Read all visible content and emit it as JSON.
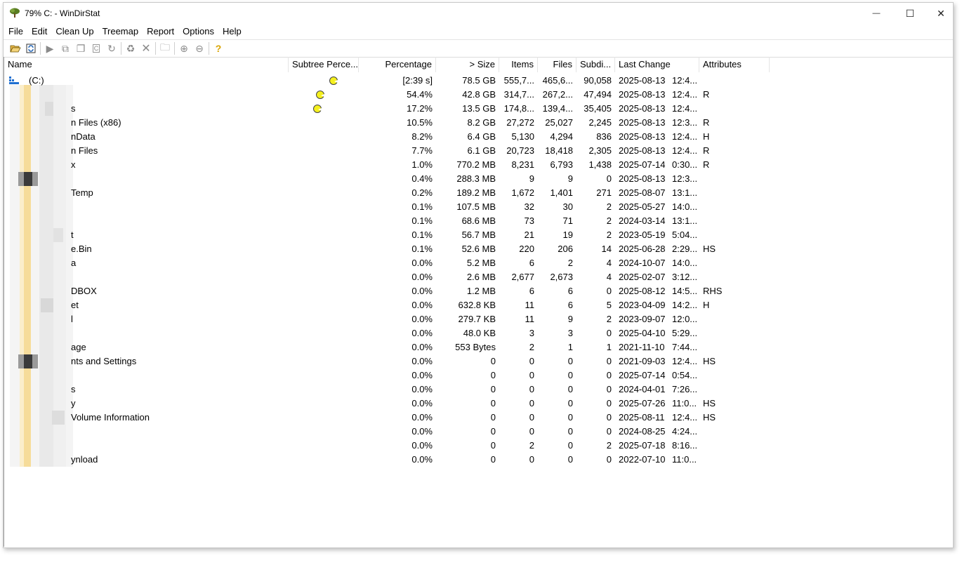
{
  "window": {
    "title": "79% C: - WinDirStat"
  },
  "controls": {
    "minimize": "—",
    "maximize": "☐",
    "close": "✕"
  },
  "menu": [
    "File",
    "Edit",
    "Clean Up",
    "Treemap",
    "Report",
    "Options",
    "Help"
  ],
  "toolbar": [
    "open-icon",
    "refresh-icon",
    "play-icon",
    "copy-icon",
    "copy2-icon",
    "csv-icon",
    "redo-icon",
    "recycle-icon",
    "delete-icon",
    "folder-icon",
    "zoom-in-icon",
    "zoom-out-icon",
    "help-icon"
  ],
  "columns": {
    "name": "Name",
    "subtree": "Subtree Perce...",
    "percentage": "Percentage",
    "size": "> Size",
    "items": "Items",
    "files": "Files",
    "subdirs": "Subdi...",
    "last_change": "Last Change",
    "attributes": "Attributes"
  },
  "colors": {
    "pacman": "#f5f01e"
  },
  "rows": [
    {
      "name": "(C:)",
      "subtree": 0.6,
      "pct": "[2:39 s]",
      "size": "78.5 GB",
      "items": "555,7...",
      "files": "465,6...",
      "subdirs": "90,058",
      "date": "2025-08-13",
      "time": "12:4...",
      "attr": ""
    },
    {
      "name": "",
      "subtree": 0.36,
      "pct": "54.4%",
      "size": "42.8 GB",
      "items": "314,7...",
      "files": "267,2...",
      "subdirs": "47,494",
      "date": "2025-08-13",
      "time": "12:4...",
      "attr": "R"
    },
    {
      "name": "s",
      "subtree": 0.31,
      "pct": "17.2%",
      "size": "13.5 GB",
      "items": "174,8...",
      "files": "139,4...",
      "subdirs": "35,405",
      "date": "2025-08-13",
      "time": "12:4...",
      "attr": ""
    },
    {
      "name": "n Files (x86)",
      "pct": "10.5%",
      "size": "8.2 GB",
      "items": "27,272",
      "files": "25,027",
      "subdirs": "2,245",
      "date": "2025-08-13",
      "time": "12:3...",
      "attr": "R"
    },
    {
      "name": "nData",
      "pct": "8.2%",
      "size": "6.4 GB",
      "items": "5,130",
      "files": "4,294",
      "subdirs": "836",
      "date": "2025-08-13",
      "time": "12:4...",
      "attr": "H"
    },
    {
      "name": "n Files",
      "pct": "7.7%",
      "size": "6.1 GB",
      "items": "20,723",
      "files": "18,418",
      "subdirs": "2,305",
      "date": "2025-08-13",
      "time": "12:4...",
      "attr": "R"
    },
    {
      "name": "x",
      "pct": "1.0%",
      "size": "770.2 MB",
      "items": "8,231",
      "files": "6,793",
      "subdirs": "1,438",
      "date": "2025-07-14",
      "time": "0:30...",
      "attr": "R"
    },
    {
      "name": "",
      "pct": "0.4%",
      "size": "288.3 MB",
      "items": "9",
      "files": "9",
      "subdirs": "0",
      "date": "2025-08-13",
      "time": "12:3...",
      "attr": ""
    },
    {
      "name": "Temp",
      "pct": "0.2%",
      "size": "189.2 MB",
      "items": "1,672",
      "files": "1,401",
      "subdirs": "271",
      "date": "2025-08-07",
      "time": "13:1...",
      "attr": ""
    },
    {
      "name": "",
      "pct": "0.1%",
      "size": "107.5 MB",
      "items": "32",
      "files": "30",
      "subdirs": "2",
      "date": "2025-05-27",
      "time": "14:0...",
      "attr": ""
    },
    {
      "name": "",
      "pct": "0.1%",
      "size": "68.6 MB",
      "items": "73",
      "files": "71",
      "subdirs": "2",
      "date": "2024-03-14",
      "time": "13:1...",
      "attr": ""
    },
    {
      "name": "t",
      "pct": "0.1%",
      "size": "56.7 MB",
      "items": "21",
      "files": "19",
      "subdirs": "2",
      "date": "2023-05-19",
      "time": "5:04...",
      "attr": ""
    },
    {
      "name": "e.Bin",
      "pct": "0.1%",
      "size": "52.6 MB",
      "items": "220",
      "files": "206",
      "subdirs": "14",
      "date": "2025-06-28",
      "time": "2:29...",
      "attr": "HS"
    },
    {
      "name": "a",
      "pct": "0.0%",
      "size": "5.2 MB",
      "items": "6",
      "files": "2",
      "subdirs": "4",
      "date": "2024-10-07",
      "time": "14:0...",
      "attr": ""
    },
    {
      "name": "",
      "pct": "0.0%",
      "size": "2.6 MB",
      "items": "2,677",
      "files": "2,673",
      "subdirs": "4",
      "date": "2025-02-07",
      "time": "3:12...",
      "attr": ""
    },
    {
      "name": "DBOX",
      "pct": "0.0%",
      "size": "1.2 MB",
      "items": "6",
      "files": "6",
      "subdirs": "0",
      "date": "2025-08-12",
      "time": "14:5...",
      "attr": "RHS"
    },
    {
      "name": "et",
      "pct": "0.0%",
      "size": "632.8 KB",
      "items": "11",
      "files": "6",
      "subdirs": "5",
      "date": "2023-04-09",
      "time": "14:2...",
      "attr": "H"
    },
    {
      "name": "l",
      "pct": "0.0%",
      "size": "279.7 KB",
      "items": "11",
      "files": "9",
      "subdirs": "2",
      "date": "2023-09-07",
      "time": "12:0...",
      "attr": ""
    },
    {
      "name": "",
      "pct": "0.0%",
      "size": "48.0 KB",
      "items": "3",
      "files": "3",
      "subdirs": "0",
      "date": "2025-04-10",
      "time": "5:29...",
      "attr": ""
    },
    {
      "name": "age",
      "pct": "0.0%",
      "size": "553 Bytes",
      "items": "2",
      "files": "1",
      "subdirs": "1",
      "date": "2021-11-10",
      "time": "7:44...",
      "attr": ""
    },
    {
      "name": "nts and Settings",
      "pct": "0.0%",
      "size": "0",
      "items": "0",
      "files": "0",
      "subdirs": "0",
      "date": "2021-09-03",
      "time": "12:4...",
      "attr": "HS"
    },
    {
      "name": "",
      "pct": "0.0%",
      "size": "0",
      "items": "0",
      "files": "0",
      "subdirs": "0",
      "date": "2025-07-14",
      "time": "0:54...",
      "attr": ""
    },
    {
      "name": "s",
      "pct": "0.0%",
      "size": "0",
      "items": "0",
      "files": "0",
      "subdirs": "0",
      "date": "2024-04-01",
      "time": "7:26...",
      "attr": ""
    },
    {
      "name": "y",
      "pct": "0.0%",
      "size": "0",
      "items": "0",
      "files": "0",
      "subdirs": "0",
      "date": "2025-07-26",
      "time": "11:0...",
      "attr": "HS"
    },
    {
      "name": "Volume Information",
      "pct": "0.0%",
      "size": "0",
      "items": "0",
      "files": "0",
      "subdirs": "0",
      "date": "2025-08-11",
      "time": "12:4...",
      "attr": "HS"
    },
    {
      "name": "",
      "pct": "0.0%",
      "size": "0",
      "items": "0",
      "files": "0",
      "subdirs": "0",
      "date": "2024-08-25",
      "time": "4:24...",
      "attr": ""
    },
    {
      "name": "",
      "pct": "0.0%",
      "size": "0",
      "items": "2",
      "files": "0",
      "subdirs": "2",
      "date": "2025-07-18",
      "time": "8:16...",
      "attr": ""
    },
    {
      "name": "ynload",
      "pct": "0.0%",
      "size": "0",
      "items": "0",
      "files": "0",
      "subdirs": "0",
      "date": "2022-07-10",
      "time": "11:0...",
      "attr": ""
    }
  ]
}
